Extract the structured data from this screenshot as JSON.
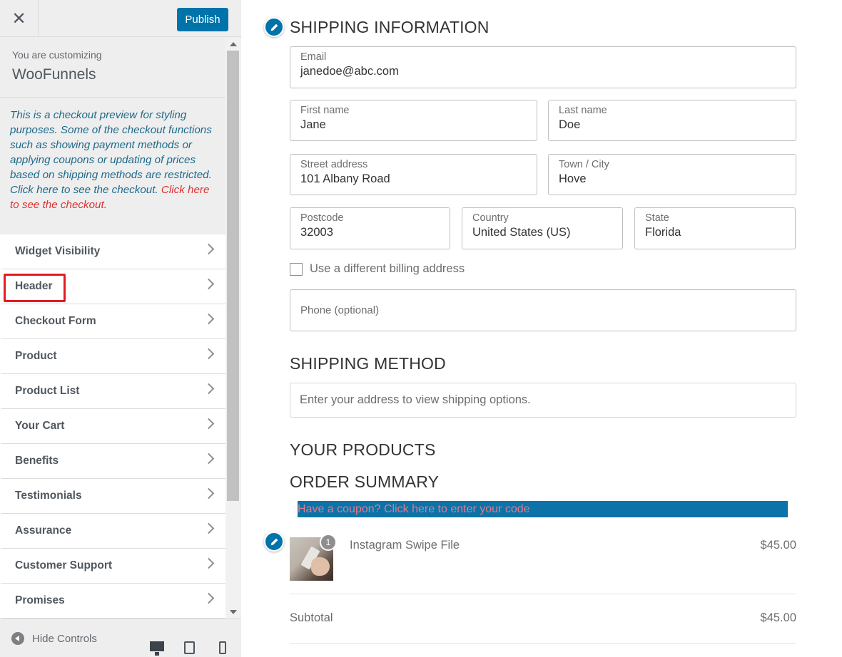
{
  "topbar": {
    "close_glyph": "✕",
    "publish_label": "Publish"
  },
  "customizing": {
    "label": "You are customizing",
    "title": "WooFunnels"
  },
  "notice": {
    "text": "This is a checkout preview for styling purposes. Some of the checkout functions such as showing payment methods or applying coupons or updating of prices based on shipping methods are restricted. Click here to see the checkout.",
    "link_text": "Click here to see the checkout."
  },
  "panels": [
    {
      "label": "Widget Visibility"
    },
    {
      "label": "Header"
    },
    {
      "label": "Checkout Form"
    },
    {
      "label": "Product"
    },
    {
      "label": "Product List"
    },
    {
      "label": "Your Cart"
    },
    {
      "label": "Benefits"
    },
    {
      "label": "Testimonials"
    },
    {
      "label": "Assurance"
    },
    {
      "label": "Customer Support"
    },
    {
      "label": "Promises"
    }
  ],
  "footer": {
    "hide_controls_label": "Hide Controls"
  },
  "shipping_info": {
    "title": "SHIPPING INFORMATION",
    "email": {
      "label": "Email",
      "value": "janedoe@abc.com"
    },
    "first_name": {
      "label": "First name",
      "value": "Jane"
    },
    "last_name": {
      "label": "Last name",
      "value": "Doe"
    },
    "street": {
      "label": "Street address",
      "value": "101 Albany Road"
    },
    "city": {
      "label": "Town / City",
      "value": "Hove"
    },
    "postcode": {
      "label": "Postcode",
      "value": "32003"
    },
    "country": {
      "label": "Country",
      "value": "United States (US)"
    },
    "state": {
      "label": "State",
      "value": "Florida"
    },
    "billing_checkbox_label": "Use a different billing address",
    "phone_placeholder": "Phone (optional)"
  },
  "shipping_method": {
    "title": "SHIPPING METHOD",
    "message": "Enter your address to view shipping options."
  },
  "products": {
    "title": "YOUR PRODUCTS"
  },
  "order_summary": {
    "title": "ORDER SUMMARY",
    "coupon_text": "Have a coupon? Click here to enter your code",
    "item": {
      "name": "Instagram Swipe File",
      "price": "$45.00",
      "quantity": "1"
    },
    "subtotal_label": "Subtotal",
    "subtotal_value": "$45.00"
  },
  "icons": {
    "close": "close-icon",
    "chevron": "chevron-right-icon",
    "pencil": "pencil-icon",
    "hide": "arrow-left-circle-icon",
    "desktop": "desktop-icon",
    "tablet": "tablet-icon",
    "mobile": "mobile-icon"
  },
  "colors": {
    "publish_button": "#0073aa",
    "highlight_box": "#e31b23",
    "coupon_bar": "#0b73a8",
    "coupon_text": "#e27a8d",
    "notice_text": "#1e6a8a",
    "notice_link": "#dc3232"
  }
}
